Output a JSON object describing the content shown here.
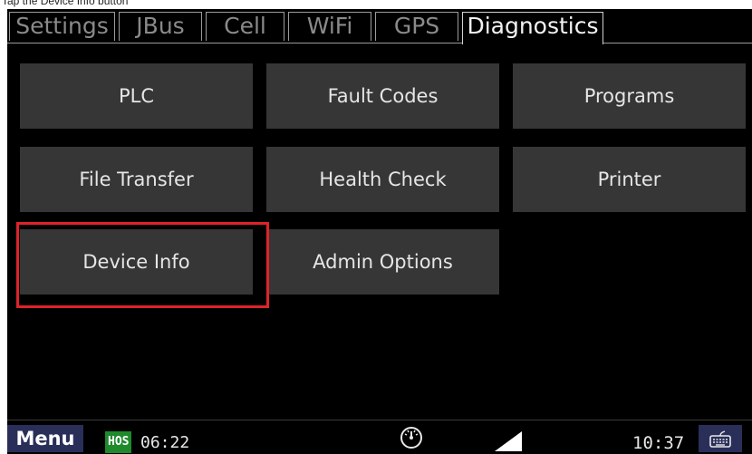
{
  "instruction": "Tap the Device Info button",
  "tabs": [
    {
      "label": "Settings"
    },
    {
      "label": "JBus"
    },
    {
      "label": "Cell"
    },
    {
      "label": "WiFi"
    },
    {
      "label": "GPS"
    },
    {
      "label": "Diagnostics"
    }
  ],
  "active_tab": "Diagnostics",
  "buttons": [
    {
      "label": "PLC"
    },
    {
      "label": "Fault Codes"
    },
    {
      "label": "Programs"
    },
    {
      "label": "File Transfer"
    },
    {
      "label": "Health Check"
    },
    {
      "label": "Printer"
    },
    {
      "label": "Device Info"
    },
    {
      "label": "Admin Options"
    }
  ],
  "highlighted_button": "Device Info",
  "status": {
    "menu_label": "Menu",
    "hos_label": "HOS",
    "hos_time": "06:22",
    "clock": "10:37"
  },
  "icons": {
    "gauge": "speedometer-icon",
    "signal": "signal-strength-icon",
    "keyboard": "keyboard-icon"
  },
  "colors": {
    "highlight": "#e0222a",
    "button_bg": "#363636",
    "menu_bg": "#2a2f5a",
    "hos_bg": "#1e8a2c"
  }
}
